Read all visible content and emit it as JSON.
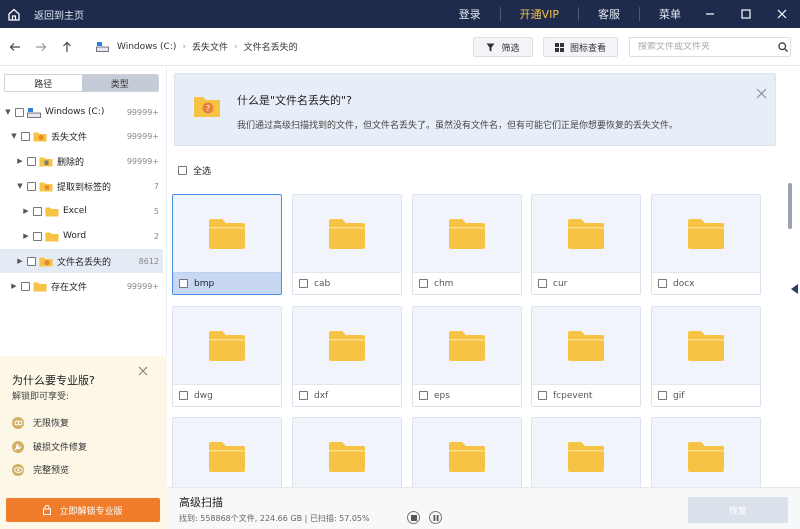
{
  "titlebar": {
    "back_label": "返回到主页",
    "login": "登录",
    "vip": "开通VIP",
    "support": "客服",
    "menu": "菜单"
  },
  "toolbar": {
    "breadcrumbs": [
      "Windows (C:)",
      "丢失文件",
      "文件名丢失的"
    ],
    "filter_label": "筛选",
    "icon_view_label": "图标查看",
    "search_placeholder": "搜索文件或文件夹"
  },
  "sidebar": {
    "tabs": [
      "路径",
      "类型"
    ],
    "tree": [
      {
        "label": "Windows (C:)",
        "count": "99999+"
      },
      {
        "label": "丢失文件",
        "count": "99999+"
      },
      {
        "label": "删除的",
        "count": "99999+"
      },
      {
        "label": "提取到标签的",
        "count": "7"
      },
      {
        "label": "Excel",
        "count": "5"
      },
      {
        "label": "Word",
        "count": "2"
      },
      {
        "label": "文件名丢失的",
        "count": "8612"
      },
      {
        "label": "存在文件",
        "count": "99999+"
      }
    ]
  },
  "promo": {
    "title": "为什么要专业版?",
    "subtitle": "解锁即可享受:",
    "features": [
      "无限恢复",
      "破损文件修复",
      "完整预览"
    ],
    "button": "立即解锁专业版"
  },
  "info": {
    "title": "什么是\"文件名丢失的\"?",
    "desc": "我们通过高级扫描找到的文件，但文件名丢失了。虽然没有文件名，但有可能它们正是你想要恢复的丢失文件。"
  },
  "select_all": "全选",
  "files": [
    "bmp",
    "cab",
    "chm",
    "cur",
    "docx",
    "dwg",
    "dxf",
    "eps",
    "fcpevent",
    "gif",
    "",
    "",
    "",
    "",
    ""
  ],
  "footer": {
    "title": "高级扫描",
    "status": "找到: 558868个文件, 224.66 GB | 已扫描: 57.05%",
    "scan_progress": 0.5705,
    "recover": "恢复"
  },
  "colors": {
    "titlebar": "#1f2b4d",
    "vip": "#f2c14e",
    "folder": "#f6c344",
    "accent_orange": "#ef7d2b",
    "selected_border": "#4a8fe7"
  }
}
